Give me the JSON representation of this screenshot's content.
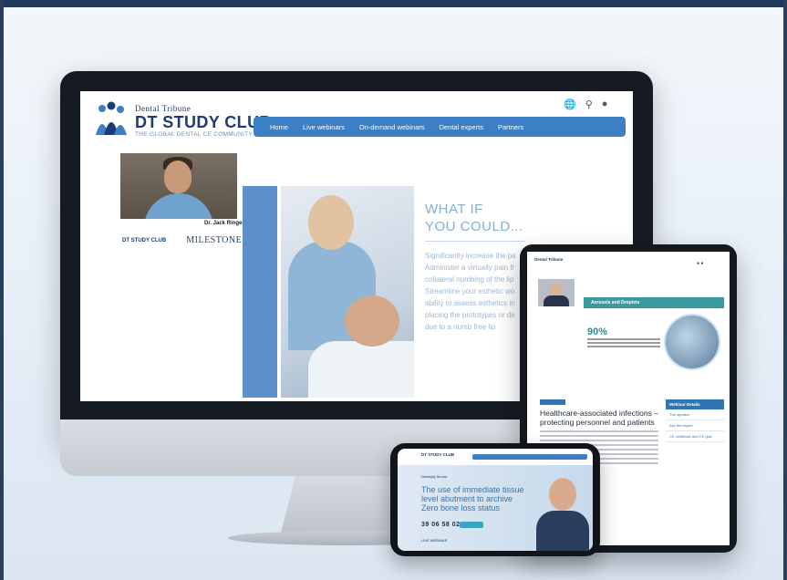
{
  "desktop": {
    "brand_small": "Dental Tribune",
    "brand_large": "DT STUDY CLUB",
    "brand_tagline": "THE GLOBAL DENTAL CE COMMUNITY",
    "nav_items": [
      "Home",
      "Live webinars",
      "On-demand webinars",
      "Dental experts",
      "Partners"
    ],
    "speaker_name": "Dr. Jack Ringer",
    "sponsor_logo_small": "DT STUDY CLUB",
    "sponsor_logo_milestone": "MILESTONE",
    "headline_line1": "WHAT IF",
    "headline_line2": "YOU COULD...",
    "bullets": [
      "Significantly increase the pa",
      "Administer a virtually pain fr",
      "collateral numbing of the lip",
      "Streamline your esthetic wo",
      "ability to assess esthetics in",
      "placing the prototypes or de",
      "due to a numb free lip"
    ]
  },
  "tablet": {
    "brand": "Dental Tribune",
    "banner": "Aerosols and Droplets",
    "stat": "90%",
    "title": "Healthcare-associated infections – protecting personnel and patients",
    "side_header": "Webinar Details",
    "side_items": [
      "The speaker",
      "Ask the expert",
      "CE certificate and CE quiz"
    ]
  },
  "phone": {
    "brand": "DT STUDY CLUB",
    "sponsor": "Dentsply Sirona",
    "headline": "The use of immediate tissue level abutment to archive Zero bone loss status",
    "date": "39 06 58 02",
    "footer": "LIVE WEBINAR"
  },
  "icons": {
    "globe": "globe-icon",
    "search": "search-icon",
    "user": "user-icon"
  },
  "colors": {
    "brand_navy": "#1b3d73",
    "nav_blue": "#3d7fc4",
    "teal": "#3a9aa0"
  }
}
